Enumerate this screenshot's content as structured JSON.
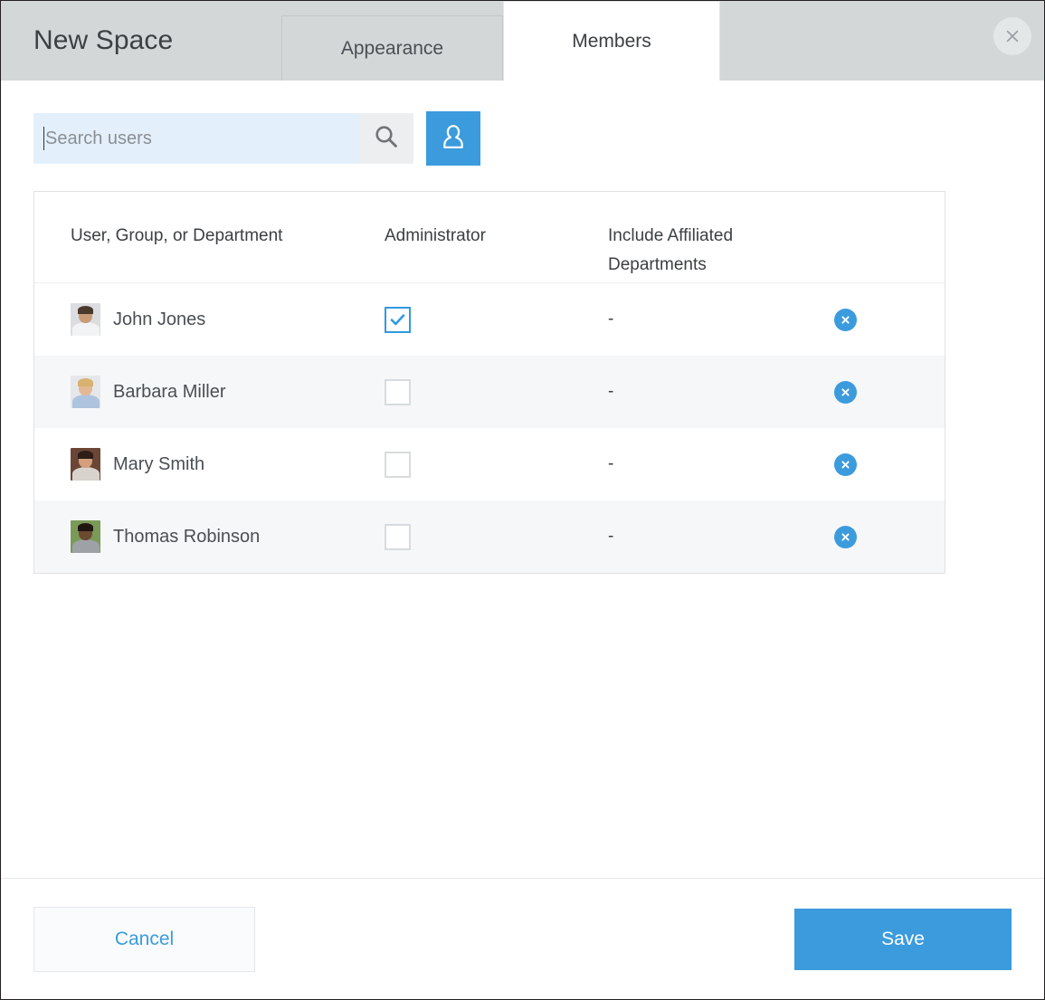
{
  "dialog": {
    "title": "New Space",
    "close_icon": "close-icon"
  },
  "tabs": [
    {
      "label": "Appearance",
      "active": false
    },
    {
      "label": "Members",
      "active": true
    }
  ],
  "search": {
    "placeholder": "Search users",
    "value": "",
    "search_icon": "search-icon",
    "add_user_icon": "person-icon"
  },
  "table": {
    "columns": [
      "User, Group, or Department",
      "Administrator",
      "Include Affiliated Departments"
    ],
    "column_header_line1": "Include Affiliated",
    "column_header_line2": "Departments",
    "rows": [
      {
        "name": "John Jones",
        "administrator": true,
        "affiliated": "-",
        "remove_icon": "remove-icon"
      },
      {
        "name": "Barbara Miller",
        "administrator": false,
        "affiliated": "-",
        "remove_icon": "remove-icon"
      },
      {
        "name": "Mary Smith",
        "administrator": false,
        "affiliated": "-",
        "remove_icon": "remove-icon"
      },
      {
        "name": "Thomas Robinson",
        "administrator": false,
        "affiliated": "-",
        "remove_icon": "remove-icon"
      }
    ]
  },
  "footer": {
    "cancel_label": "Cancel",
    "save_label": "Save"
  },
  "colors": {
    "accent": "#3b9bdd",
    "header_bg": "#d3d7d8",
    "search_bg": "#e3f0fb",
    "row_alt_bg": "#f6f7f9",
    "checkbox_checked_border": "#2f9ae0"
  }
}
